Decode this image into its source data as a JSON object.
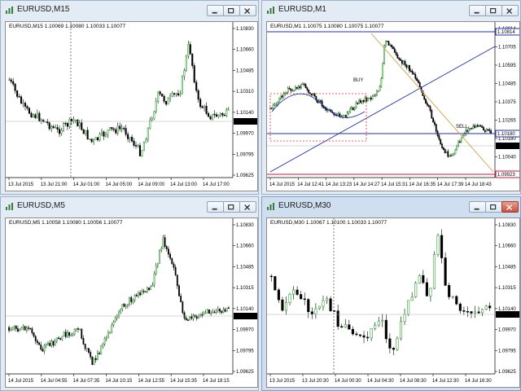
{
  "windows": [
    {
      "title": "EURUSD,M15",
      "ohlc": "EURUSD,M15  1.10069 1.10080 1.10033 1.10077",
      "price_labels": [
        "1.10830",
        "1.10660",
        "1.10485",
        "1.10310",
        "1.10140",
        "1.09970",
        "1.09795",
        "1.09625"
      ],
      "current_price": "1.10077",
      "time_labels": [
        "13 Jul 2015",
        "13 Jul 21:00",
        "14 Jul 01:00",
        "14 Jul 05:00",
        "14 Jul 09:00",
        "14 Jul 13:00",
        "14 Jul 17:00"
      ]
    },
    {
      "title": "EURUSD,M1",
      "ohlc": "EURUSD,M1  1.10075 1.10080 1.10075 1.10077",
      "price_labels": [
        "1.10814",
        "1.10705",
        "1.10595",
        "1.10485",
        "1.10375",
        "1.10265",
        "1.10180",
        "1.10040",
        "1.09923"
      ],
      "current_price": "1.10077",
      "level_high": "1.10814",
      "level_mid": "1.10180",
      "level_low": "1.09923",
      "buy_label": "BUY",
      "sell_label": "SELL",
      "time_labels": [
        "14 Jul 2015",
        "14 Jul 12:41",
        "14 Jul 13:23",
        "14 Jul 14:27",
        "14 Jul 15:31",
        "14 Jul 16:35",
        "14 Jul 17:39",
        "14 Jul 18:43"
      ]
    },
    {
      "title": "EURUSD,M5",
      "ohlc": "EURUSD,M5  1.10058 1.10080 1.10056 1.10077",
      "price_labels": [
        "1.10830",
        "1.10660",
        "1.10485",
        "1.10315",
        "1.10140",
        "1.09970",
        "1.09795",
        "1.09625"
      ],
      "current_price": "1.10077",
      "time_labels": [
        "14 Jul 2015",
        "14 Jul 04:55",
        "14 Jul 07:35",
        "14 Jul 10:15",
        "14 Jul 12:55",
        "14 Jul 15:35",
        "14 Jul 18:15"
      ]
    },
    {
      "title": "EURUSD,M30",
      "ohlc": "EURUSD,M30  1.10067 1.10100 1.10033 1.10077",
      "price_labels": [
        "1.10830",
        "1.10660",
        "1.10485",
        "1.10315",
        "1.10140",
        "1.09970",
        "1.09795",
        "1.09625"
      ],
      "current_price": "1.10077",
      "time_labels": [
        "13 Jul 2015",
        "13 Jul 20:30",
        "14 Jul 00:30",
        "14 Jul 04:30",
        "14 Jul 08:30",
        "14 Jul 12:30",
        "14 Jul 16:30"
      ]
    }
  ],
  "colors": {
    "bull": "#2f9e2f",
    "bear": "#000000",
    "level_line": "#1f2fb0",
    "resistance_line": "#c9a24a",
    "level_low": "#d7143c",
    "buy_box": "#e03030"
  }
}
